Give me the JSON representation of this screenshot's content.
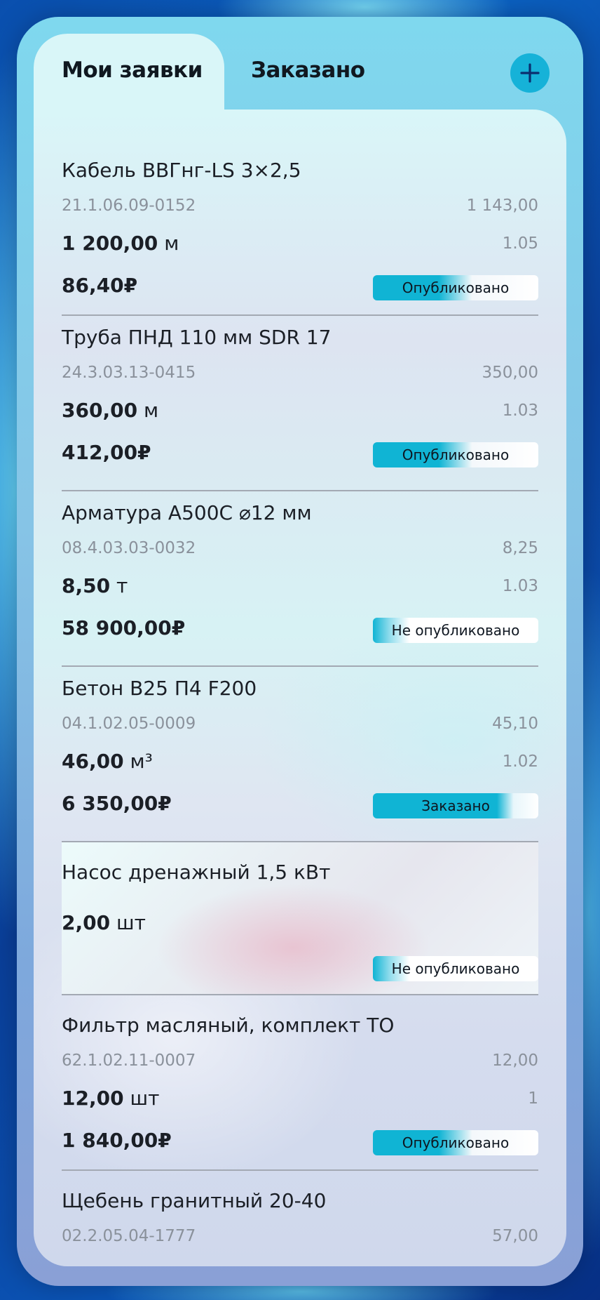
{
  "tabs": {
    "active_label": "Мои заявки",
    "inactive_label": "Заказано"
  },
  "add_button_icon": "plus-icon",
  "items": [
    {
      "name": "Кабель ВВГнг-LS 3×2,5",
      "code": "21.1.06.09-0152",
      "price": "1 143,00",
      "qty": "1 200,00",
      "unit": "м",
      "coef": "1.05",
      "sum": "86,40₽",
      "status": "Опубликовано",
      "status_type": "published"
    },
    {
      "name": "Труба ПНД 110 мм SDR 17",
      "code": "24.3.03.13-0415",
      "price": "350,00",
      "qty": "360,00",
      "unit": "м",
      "coef": "1.03",
      "sum": "412,00₽",
      "status": "Опубликовано",
      "status_type": "published"
    },
    {
      "name": "Арматура А500С ⌀12 мм",
      "code": "08.4.03.03-0032",
      "price": "8,25",
      "qty": "8,50",
      "unit": "т",
      "coef": "1.03",
      "sum": "58 900,00₽",
      "status": "Не опубликовано",
      "status_type": "unpublished"
    },
    {
      "name": "Бетон В25 П4 F200",
      "code": "04.1.02.05-0009",
      "price": "45,10",
      "qty": "46,00",
      "unit": "м³",
      "coef": "1.02",
      "sum": "6 350,00₽",
      "status": "Заказано",
      "status_type": "ordered"
    },
    {
      "name": "Насос дренажный 1,5 кВт",
      "qty": "2,00",
      "unit": "шт",
      "status": "Не опубликовано",
      "status_type": "unpublished"
    },
    {
      "name": "Фильтр масляный, комплект ТО",
      "code": "62.1.02.11-0007",
      "price": "12,00",
      "qty": "12,00",
      "unit": "шт",
      "coef": "1",
      "sum": "1 840,00₽",
      "status": "Опубликовано",
      "status_type": "published"
    },
    {
      "name": "Щебень гранитный 20-40",
      "code": "02.2.05.04-1777",
      "price": "57,00"
    }
  ]
}
